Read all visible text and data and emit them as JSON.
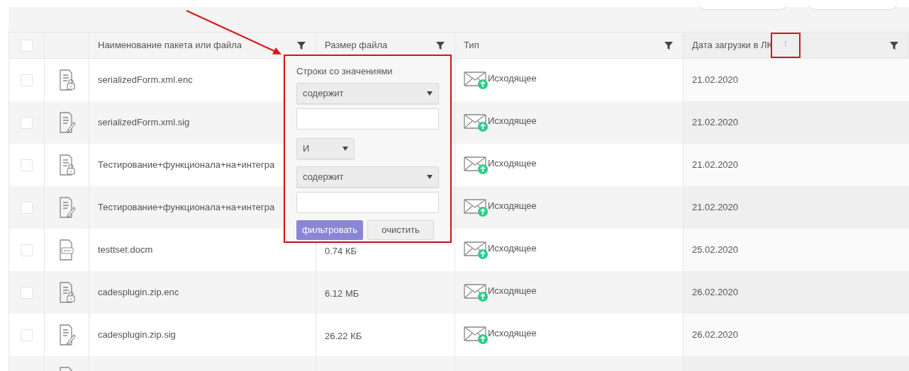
{
  "table": {
    "select_all": {
      "checked": false
    },
    "columns": [
      {
        "label": "Наименование пакета или файла"
      },
      {
        "label": "Размер файла"
      },
      {
        "label": "Тип"
      },
      {
        "label": "Дата загрузки в ЛК",
        "sort_indicator": "↑",
        "highlighted": true
      }
    ],
    "rows": [
      {
        "checked": false,
        "kind": "encrypted",
        "name": "serializedForm.xml.enc",
        "type": "Исходящее",
        "date": "21.02.2020"
      },
      {
        "checked": false,
        "kind": "signature",
        "name": "serializedForm.xml.sig",
        "type": "Исходящее",
        "date": "21.02.2020"
      },
      {
        "checked": false,
        "kind": "encrypted",
        "name": "Тестирование+функционала+на+интегра",
        "type": "Исходящее",
        "date": "21.02.2020"
      },
      {
        "checked": false,
        "kind": "signature",
        "name": "Тестирование+функционала+на+интегра",
        "type": "Исходящее",
        "date": "21.02.2020"
      },
      {
        "checked": false,
        "kind": "doc",
        "name": "testtset.docm",
        "size": "0.74 КБ",
        "type": "Исходящее",
        "date": "25.02.2020"
      },
      {
        "checked": false,
        "kind": "encrypted",
        "name": "cadesplugin.zip.enc",
        "size": "6.12 МБ",
        "type": "Исходящее",
        "date": "26.02.2020"
      },
      {
        "checked": false,
        "kind": "signature",
        "name": "cadesplugin.zip.sig",
        "size": "26.22 КБ",
        "type": "Исходящее",
        "date": "26.02.2020"
      },
      {
        "kind": "file"
      }
    ]
  },
  "filter_popup": {
    "highlighted": true,
    "title": "Строки со значениями",
    "condition_1": "содержит",
    "logic": "И",
    "condition_2": "содержит",
    "buttons": [
      {
        "label": "фильтровать",
        "kind": "primary"
      },
      {
        "label": "очистить",
        "kind": "secondary"
      }
    ]
  },
  "callout_arrow": true
}
